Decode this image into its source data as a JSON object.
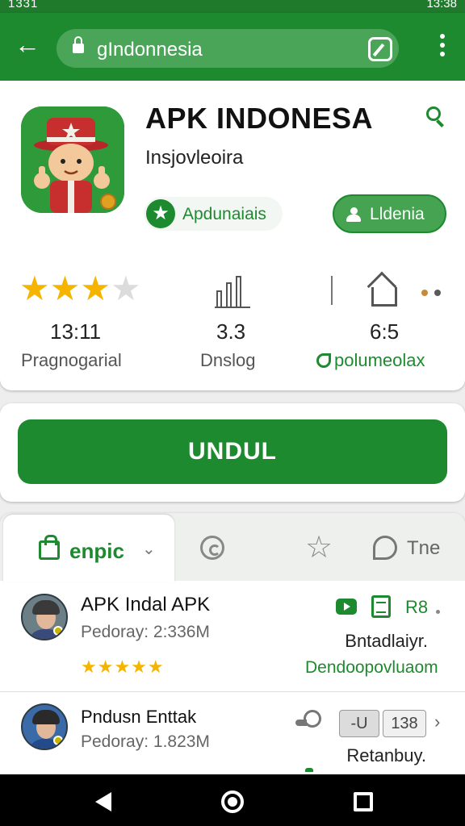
{
  "status_bar": {
    "left_text": "1331",
    "right_text": "13:38"
  },
  "toolbar": {
    "url": "gIndonnesia"
  },
  "app": {
    "name": "APK INDONESA",
    "subtitle": "Insjovleoira",
    "badge_label": "Apdunaiais",
    "update_label": "Lldenia"
  },
  "stats": {
    "rating": {
      "value": "13:11",
      "label": "Pragnogarial",
      "stars_filled": 3,
      "stars_total": 4
    },
    "downloads": {
      "value": "3.3",
      "label": "Dnslog"
    },
    "size": {
      "value": "6:5",
      "label": "polumeolax"
    },
    "accent_color": "#1e8a2f",
    "dot_colors": [
      "#c8893a",
      "#5a5a5a"
    ]
  },
  "install": {
    "label": "UNDUL"
  },
  "tabs": {
    "active_label": "enpic",
    "last_label": "Tne"
  },
  "list": [
    {
      "title": "APK Indal APK",
      "meta": "Pedoray: 2:336M",
      "stars": "★★★★★",
      "rb_label": "R8",
      "right_text": "Bntadlaiyr.",
      "link_text": "Dendoopovluaom"
    },
    {
      "title": "Pndusn Enttak",
      "meta": "Pedoray: 1.823M",
      "chip_1": "-U",
      "chip_2": "138",
      "right_text": "Retanbuy."
    }
  ]
}
